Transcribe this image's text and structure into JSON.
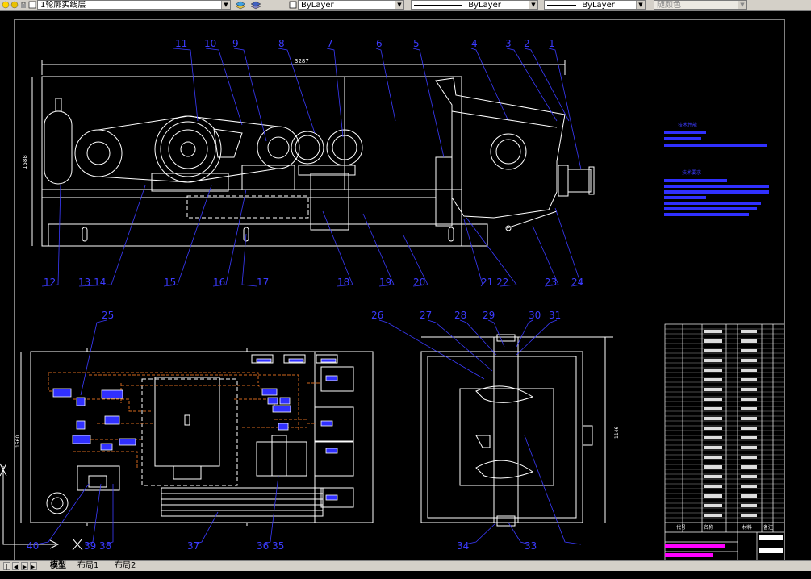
{
  "toolbar": {
    "layer_name": "1轮廓实线层",
    "color_control": "ByLayer",
    "linetype_control": "ByLayer",
    "lineweight_control": "ByLayer",
    "plot_style": "随颜色"
  },
  "drawing": {
    "dimension_length": "3287",
    "dimension_height": "1588",
    "dimension_height_plan": "1560",
    "dimension_width_right": "1146",
    "balloons_top": [
      "11",
      "10",
      "9",
      "8",
      "7",
      "6",
      "5",
      "4",
      "3",
      "2",
      "1"
    ],
    "balloons_bottom_row": [
      "12",
      "13 14",
      "15",
      "16",
      "17",
      "18",
      "19",
      "20",
      "21 22",
      "23",
      "24"
    ],
    "balloons_plan_top": [
      "25",
      "26",
      "27",
      "28",
      "29",
      "30",
      "31"
    ],
    "balloons_plan_bottom": [
      "40",
      "39",
      "38",
      "37",
      "36 35",
      "34",
      "33"
    ],
    "tech_title_1": "技术性能",
    "tech_title_2": "技术要求"
  },
  "title_block": {
    "col_1": "代号",
    "col_2": "名称",
    "col_3": "材料",
    "col_4": "备注"
  },
  "status": {
    "tab_model": "模型",
    "tab_layout1": "布局1",
    "tab_layout2": "布局2"
  },
  "colors": {
    "drawing_line": "#ffffff",
    "balloon": "#3b3bff",
    "hidden_line": "#d2691e",
    "highlight": "#3030ff",
    "magenta": "#ff00ff"
  }
}
